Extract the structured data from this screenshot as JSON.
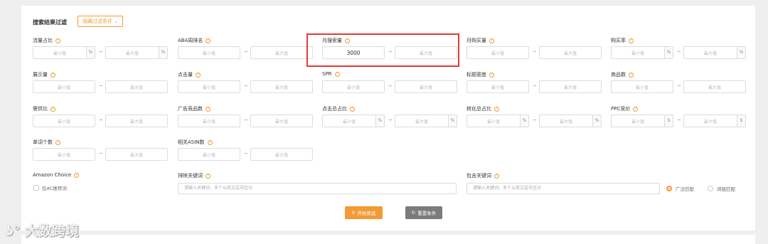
{
  "header": {
    "title": "搜索结果过滤",
    "toggle_label": "隐藏过滤条件"
  },
  "placeholders": {
    "min": "最小值",
    "max": "最大值"
  },
  "units": {
    "percent": "%",
    "dollar": "$"
  },
  "range_filters": [
    {
      "label": "流量占比",
      "unit": "%"
    },
    {
      "label": "ABA周排名",
      "unit": ""
    },
    {
      "label": "月搜索量",
      "unit": "",
      "min_value": "3000"
    },
    {
      "label": "月购买量",
      "unit": ""
    },
    {
      "label": "购买率",
      "unit": "%"
    },
    {
      "label": "展示量",
      "unit": ""
    },
    {
      "label": "点击量",
      "unit": ""
    },
    {
      "label": "SPR",
      "unit": ""
    },
    {
      "label": "标题密度",
      "unit": ""
    },
    {
      "label": "商品数",
      "unit": ""
    },
    {
      "label": "需供比",
      "unit": ""
    },
    {
      "label": "广告竞品数",
      "unit": ""
    },
    {
      "label": "点击总占比",
      "unit": "%"
    },
    {
      "label": "转化总占比",
      "unit": "%"
    },
    {
      "label": "PPC竞价",
      "unit": "$"
    },
    {
      "label": "单词个数",
      "unit": ""
    },
    {
      "label": "相关ASIN数",
      "unit": ""
    }
  ],
  "amazon_choice": {
    "label": "Amazon Choice",
    "checkbox_label": "仅AC推荐词"
  },
  "exclude": {
    "label": "排除关键词",
    "placeholder": "请输入关键词，多个以英文逗号区分"
  },
  "include": {
    "label": "包含关键词",
    "placeholder": "请输入关键词，多个以英文逗号区分",
    "match_broad": "广泛匹配",
    "match_phrase": "词组匹配"
  },
  "actions": {
    "start": "开始筛选",
    "reset": "重置条件"
  },
  "watermark": "大数跨境",
  "colors": {
    "accent": "#f39a35",
    "highlight": "#e53b34",
    "reset_button": "#7b7b7b"
  }
}
